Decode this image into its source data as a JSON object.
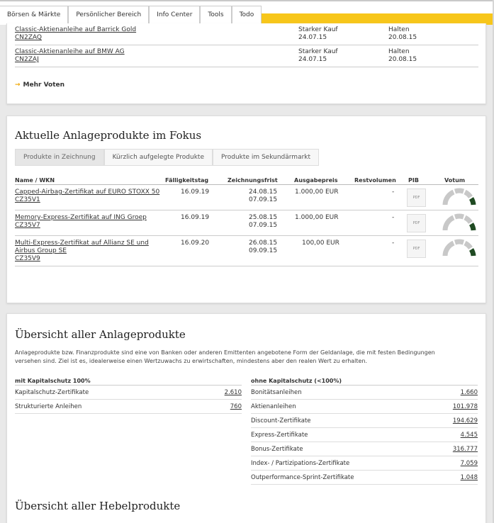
{
  "nav": {
    "tabs": [
      "Börsen & Märkte",
      "Persönlicher Bereich",
      "Info Center",
      "Tools",
      "Todo"
    ]
  },
  "votes": {
    "rows": [
      {
        "name": "Classic-Aktienanleihe auf Barrick Gold",
        "wkn": "CN2ZAQ",
        "vote1": "Starker Kauf",
        "date1": "24.07.15",
        "vote2": "Halten",
        "date2": "20.08.15"
      },
      {
        "name": "Classic-Aktienanleihe auf BMW AG",
        "wkn": "CN2ZAJ",
        "vote1": "Starker Kauf",
        "date1": "24.07.15",
        "vote2": "Halten",
        "date2": "20.08.15"
      }
    ],
    "more_label": "Mehr Voten"
  },
  "focus": {
    "title": "Aktuelle Anlageprodukte im Fokus",
    "tabs": [
      "Produkte in Zeichnung",
      "Kürzlich aufgelegte Produkte",
      "Produkte im Sekundärmarkt"
    ],
    "headers": {
      "name": "Name / WKN",
      "maturity": "Fälligkeitstag",
      "subscription": "Zeichnungsfrist",
      "price": "Ausgabepreis",
      "volume": "Restvolumen",
      "pib": "PIB",
      "vote": "Votum"
    },
    "pdf_label": "PDF",
    "rows": [
      {
        "name": "Capped-Airbag-Zertifikat auf EURO STOXX 50",
        "wkn": "CZ35V1",
        "maturity": "16.09.19",
        "from": "24.08.15",
        "to": "07.09.15",
        "price": "1.000,00 EUR",
        "volume": "-"
      },
      {
        "name": "Memory-Express-Zertifikat auf ING Groep",
        "wkn": "CZ35V7",
        "maturity": "16.09.19",
        "from": "25.08.15",
        "to": "07.09.15",
        "price": "1.000,00 EUR",
        "volume": "-"
      },
      {
        "name1": "Multi-Express-Zertifikat auf Allianz SE und",
        "name2": "Airbus Group SE",
        "wkn": "CZ35V9",
        "maturity": "16.09.20",
        "from": "26.08.15",
        "to": "09.09.15",
        "price": "100,00 EUR",
        "volume": "-"
      }
    ]
  },
  "overview": {
    "title": "Übersicht aller Anlageprodukte",
    "desc1": "Anlageprodukte bzw. Finanzprodukte sind eine von Banken oder anderen Emittenten angebotene Form der Geldanlage, die mit festen Bedingungen",
    "desc2": "versehen sind. Ziel ist es, idealerweise einen Wertzuwachs zu erwirtschaften, mindestens aber den realen Wert zu erhalten.",
    "left_header": "mit Kapitalschutz 100%",
    "left": [
      {
        "label": "Kapitalschutz-Zertifikate",
        "count": "2.610"
      },
      {
        "label": "Strukturierte Anleihen",
        "count": "760"
      }
    ],
    "right_header": "ohne Kapitalschutz (<100%)",
    "right": [
      {
        "label": "Bonitätsanleihen",
        "count": "1.660"
      },
      {
        "label": "Aktienanleihen",
        "count": "101.978"
      },
      {
        "label": "Discount-Zertifikate",
        "count": "194.629"
      },
      {
        "label": "Express-Zertifikate",
        "count": "4.545"
      },
      {
        "label": "Bonus-Zertifikate",
        "count": "316.777"
      },
      {
        "label": "Index- / Partizipations-Zertifikate",
        "count": "7.059"
      },
      {
        "label": "Outperformance-Sprint-Zertifikate",
        "count": "1.048"
      }
    ],
    "lever_title": "Übersicht aller Hebelprodukte"
  },
  "colors": {
    "accent": "#f7c61a",
    "gauge_light": "#c8c8c8",
    "gauge_dark": "#1f4a22"
  }
}
